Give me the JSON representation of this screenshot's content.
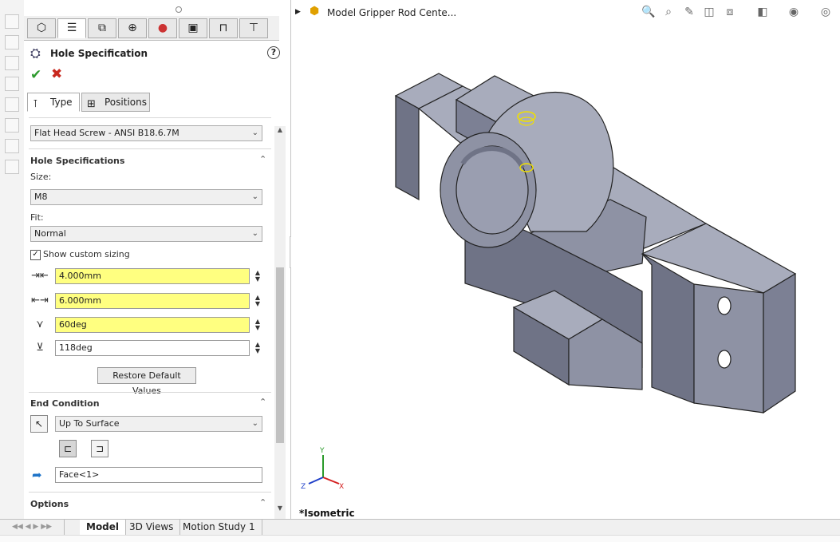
{
  "feature": {
    "title": "Hole Specification",
    "help": "?"
  },
  "subtabs": [
    {
      "label": "Type"
    },
    {
      "label": "Positions"
    }
  ],
  "hole_type": "Flat Head Screw - ANSI B18.6.7M",
  "hole_specifications": {
    "title": "Hole Specifications",
    "size_label": "Size:",
    "size_value": "M8",
    "fit_label": "Fit:",
    "fit_value": "Normal",
    "custom_sizing_label": "Show custom sizing",
    "custom_sizing_checked": true,
    "dimensions": [
      {
        "icon": "through-hole-diameter-icon",
        "value": "4.000mm",
        "highlight": true
      },
      {
        "icon": "countersink-diameter-icon",
        "value": "6.000mm",
        "highlight": true
      },
      {
        "icon": "countersink-angle-icon",
        "value": "60deg",
        "highlight": true
      },
      {
        "icon": "drill-angle-icon",
        "value": "118deg",
        "highlight": false
      }
    ],
    "restore_label": "Restore Default Values"
  },
  "end_condition": {
    "title": "End Condition",
    "value": "Up To Surface",
    "face": "Face<1>"
  },
  "options": {
    "title": "Options"
  },
  "viewport": {
    "model_name": "Model Gripper Rod Cente...",
    "view_label": "*Isometric",
    "triad": {
      "x": "X",
      "y": "Y",
      "z": "Z"
    }
  },
  "bottom_tabs": [
    {
      "label": "Model",
      "active": true
    },
    {
      "label": "3D Views",
      "active": false
    },
    {
      "label": "Motion Study 1",
      "active": false
    }
  ],
  "colors": {
    "highlight_field": "#ffff80",
    "accept": "#2f9b2f",
    "cancel": "#c8281e",
    "model_face_light": "#a8acbc",
    "model_face_mid": "#8e92a4",
    "model_face_dark": "#6f7386"
  }
}
